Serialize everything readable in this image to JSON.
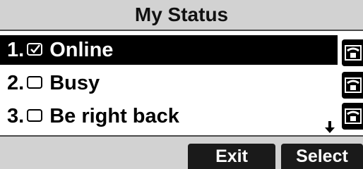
{
  "title": "My Status",
  "items": [
    {
      "number": "1.",
      "label": "Online",
      "checked": true
    },
    {
      "number": "2.",
      "label": "Busy",
      "checked": false
    },
    {
      "number": "3.",
      "label": "Be right back",
      "checked": false
    }
  ],
  "line_keys": [
    {
      "icon": "phone-handset-icon"
    },
    {
      "icon": "phone-handset-icon"
    },
    {
      "icon": "phone-handset-icon"
    }
  ],
  "scroll_indicator": "scroll-down-arrow-icon",
  "softkeys": {
    "exit": "Exit",
    "select": "Select"
  },
  "colors": {
    "bar_background": "#d2d2d2",
    "selected_background": "#000000",
    "softkey_background": "#1a1a1a"
  }
}
